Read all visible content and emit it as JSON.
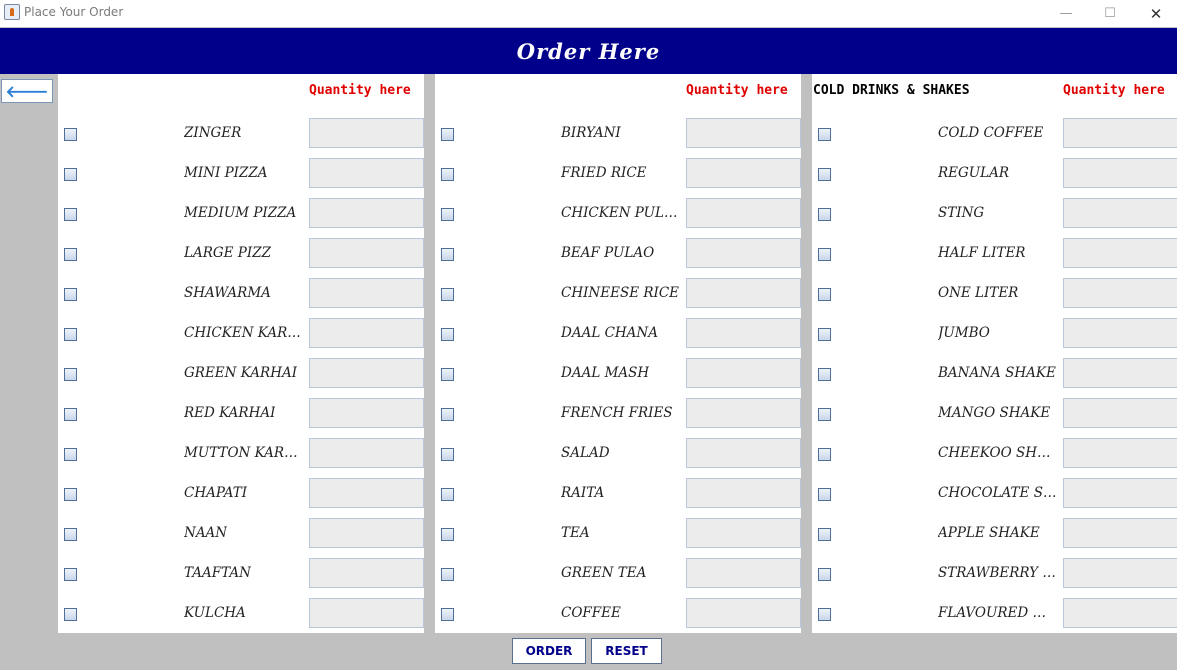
{
  "window": {
    "title": "Place Your Order",
    "minimize": "—",
    "maximize": "☐",
    "close": "✕"
  },
  "header": {
    "title": "Order Here"
  },
  "back_button": {
    "label": "🡐"
  },
  "columns": [
    {
      "heading": "",
      "qty_heading": "Quantity here",
      "items": [
        "ZINGER",
        "MINI PIZZA",
        "MEDIUM PIZZA",
        "LARGE PIZZ",
        "SHAWARMA",
        "CHICKEN KARH...",
        "GREEN KARHAI",
        "RED KARHAI",
        "MUTTON KARH...",
        "CHAPATI",
        "NAAN",
        "TAAFTAN",
        "KULCHA"
      ]
    },
    {
      "heading": "",
      "qty_heading": "Quantity here",
      "items": [
        "BIRYANI",
        "FRIED RICE",
        "CHICKEN PULAO",
        "BEAF PULAO",
        "CHINEESE RICE",
        "DAAL CHANA",
        "DAAL MASH",
        "FRENCH FRIES",
        "SALAD",
        "RAITA",
        "TEA",
        "GREEN TEA",
        "COFFEE"
      ]
    },
    {
      "heading": "COLD DRINKS  &  SHAKES",
      "qty_heading": "Quantity here",
      "items": [
        "COLD COFFEE",
        "REGULAR",
        "STING",
        "HALF LITER",
        "ONE LITER",
        "JUMBO",
        "BANANA SHAKE",
        "MANGO SHAKE",
        "CHEEKOO SHAKE",
        "CHOCOLATE SH...",
        "APPLE SHAKE",
        "STRAWBERRY S...",
        "FLAVOURED MILK"
      ]
    }
  ],
  "buttons": {
    "order": "ORDER",
    "reset": "RESET"
  },
  "colors": {
    "header_bg": "#00008b",
    "quantity_heading": "#e00000",
    "button_text": "#00008b"
  }
}
